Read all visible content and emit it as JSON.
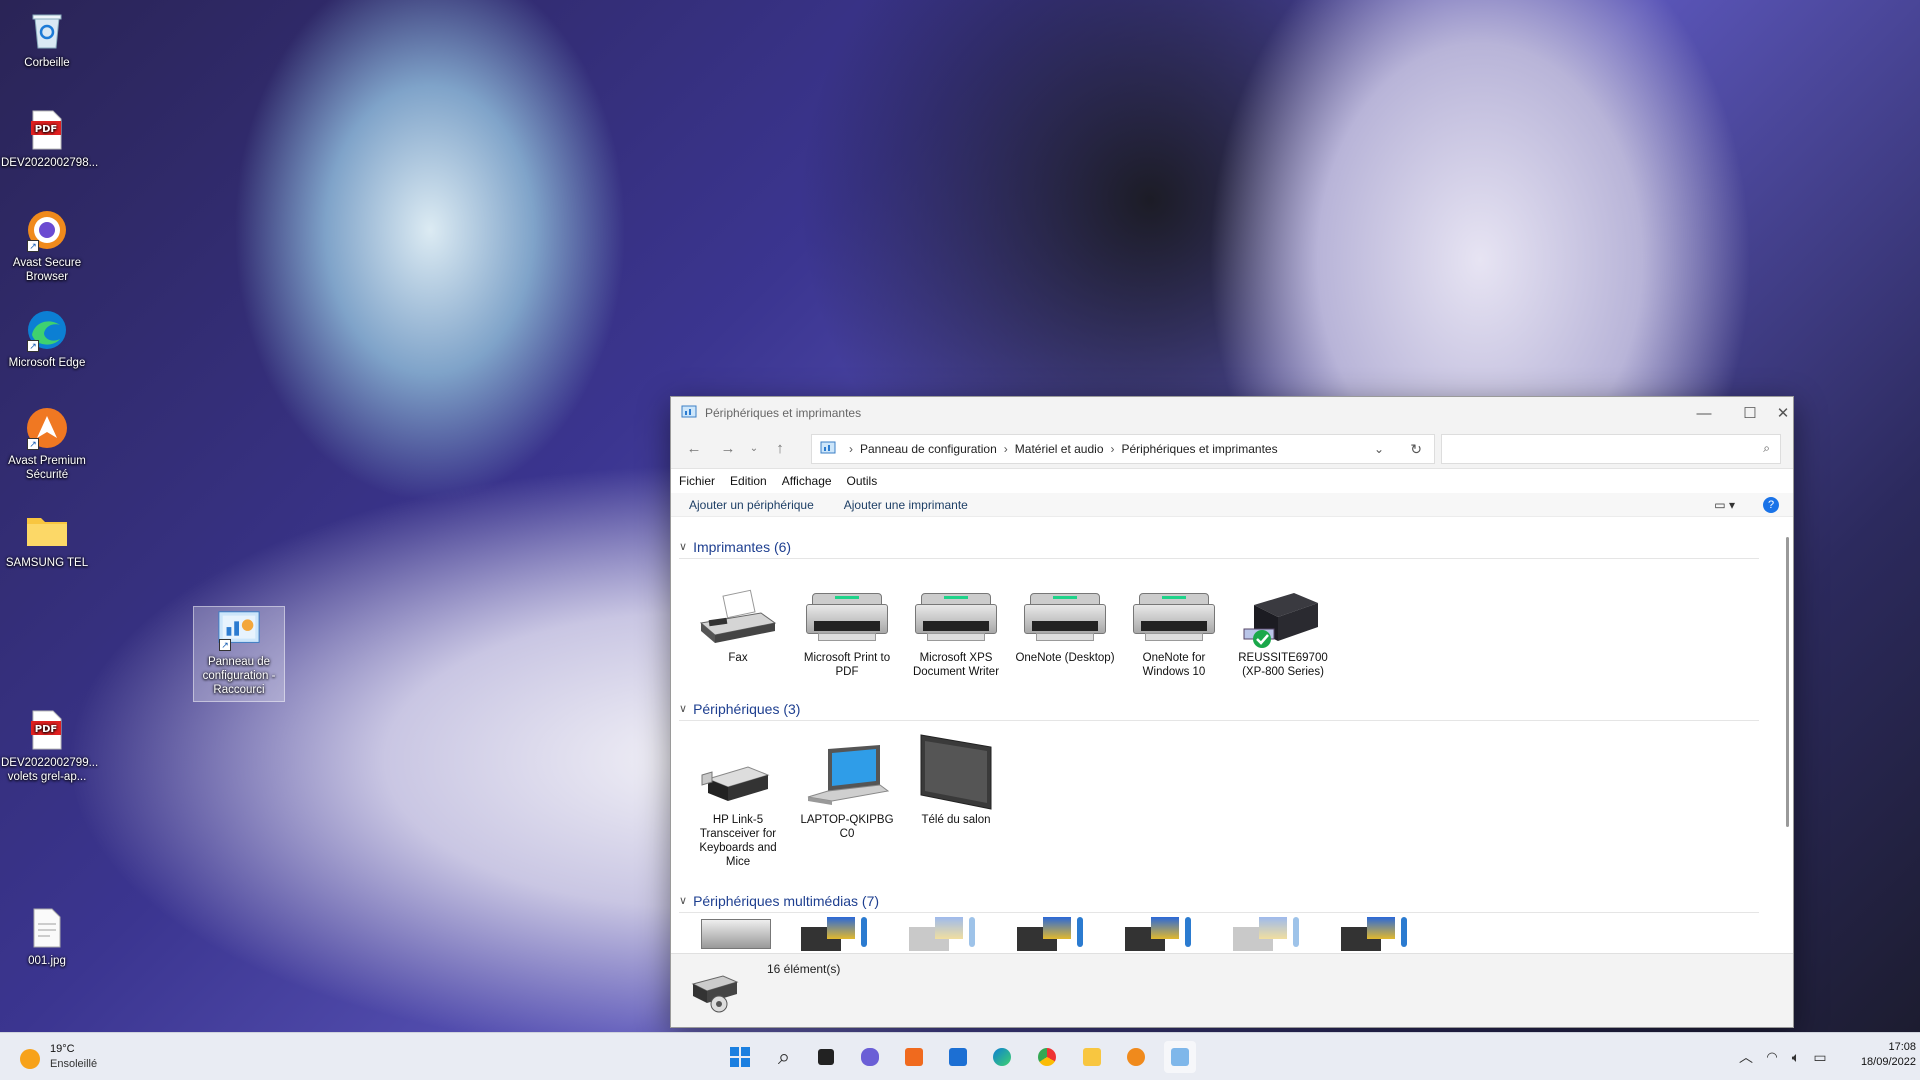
{
  "desktop": {
    "icons": [
      {
        "label": "Corbeille",
        "icon": "recycle-bin-icon"
      },
      {
        "label": "DEV2022002798...",
        "icon": "pdf-file-icon"
      },
      {
        "label": "Avast Secure Browser",
        "icon": "avast-secure-browser-icon"
      },
      {
        "label": "Microsoft Edge",
        "icon": "edge-icon"
      },
      {
        "label": "Avast Premium Sécurité",
        "icon": "avast-premium-icon"
      },
      {
        "label": "SAMSUNG TEL",
        "icon": "folder-icon"
      },
      {
        "label": "Panneau de configuration - Raccourci",
        "icon": "control-panel-icon"
      },
      {
        "label": "DEV2022002799... volets grel-ap...",
        "icon": "pdf-file-icon"
      },
      {
        "label": "001.jpg",
        "icon": "image-file-icon"
      }
    ],
    "pdf_badge": "PDF"
  },
  "window": {
    "title": "Périphériques et imprimantes",
    "breadcrumb": [
      "Panneau de configuration",
      "Matériel et audio",
      "Périphériques et imprimantes"
    ],
    "search_placeholder": "",
    "menu": [
      "Fichier",
      "Edition",
      "Affichage",
      "Outils"
    ],
    "commands": [
      "Ajouter un périphérique",
      "Ajouter une imprimante"
    ],
    "groups": [
      {
        "label": "Imprimantes (6)",
        "items": [
          "Fax",
          "Microsoft Print to PDF",
          "Microsoft XPS Document Writer",
          "OneNote (Desktop)",
          "OneNote for Windows 10",
          "REUSSITE69700 (XP-800 Series)"
        ]
      },
      {
        "label": "Périphériques (3)",
        "items": [
          "HP Link-5 Transceiver for Keyboards and Mice",
          "LAPTOP-QKIPBG C0",
          "Télé du salon"
        ]
      },
      {
        "label": "Périphériques multimédias (7)",
        "items": []
      }
    ],
    "status": "16 élément(s)"
  },
  "taskbar": {
    "weather_temp": "19°C",
    "weather_desc": "Ensoleillé",
    "time": "17:08",
    "date": "18/09/2022",
    "apps": [
      "start-icon",
      "search-icon",
      "task-view-icon",
      "teams-chat-icon",
      "avast-icon",
      "mail-icon",
      "edge-icon",
      "chrome-icon",
      "file-explorer-icon",
      "avast-browser-icon",
      "control-panel-icon"
    ]
  }
}
